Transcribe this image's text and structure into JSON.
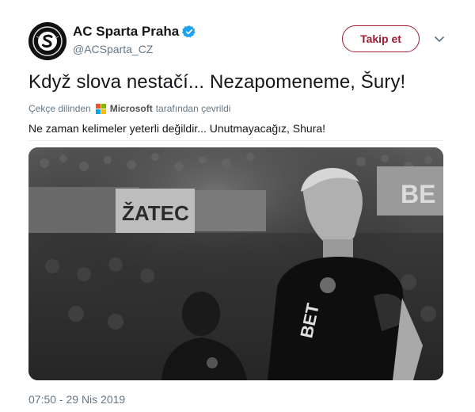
{
  "account": {
    "display_name": "AC Sparta Praha",
    "handle": "@ACSparta_CZ",
    "verified": true,
    "avatar_icon": "ac-sparta-crest-icon"
  },
  "actions": {
    "follow_label": "Takip et",
    "more_icon": "chevron-down-icon"
  },
  "tweet": {
    "text": "Když slova nestačí... Nezapomeneme, Šury!",
    "translated_prefix": "Çekçe dilinden",
    "translator": "Microsoft",
    "translated_suffix": "tarafından çevrildi",
    "translation": "Ne zaman kelimeler yeterli değildir... Unutmayacağız, Shura!",
    "timestamp": "07:50 - 29 Nis 2019"
  },
  "media": {
    "banner_left": "ŽATEC",
    "banner_right": "BE",
    "shirt_text": "BET",
    "style": "black-and-white"
  },
  "colors": {
    "accent": "#9e1b32",
    "verified_blue": "#1da1f2",
    "text": "#14171a",
    "muted": "#657786"
  }
}
